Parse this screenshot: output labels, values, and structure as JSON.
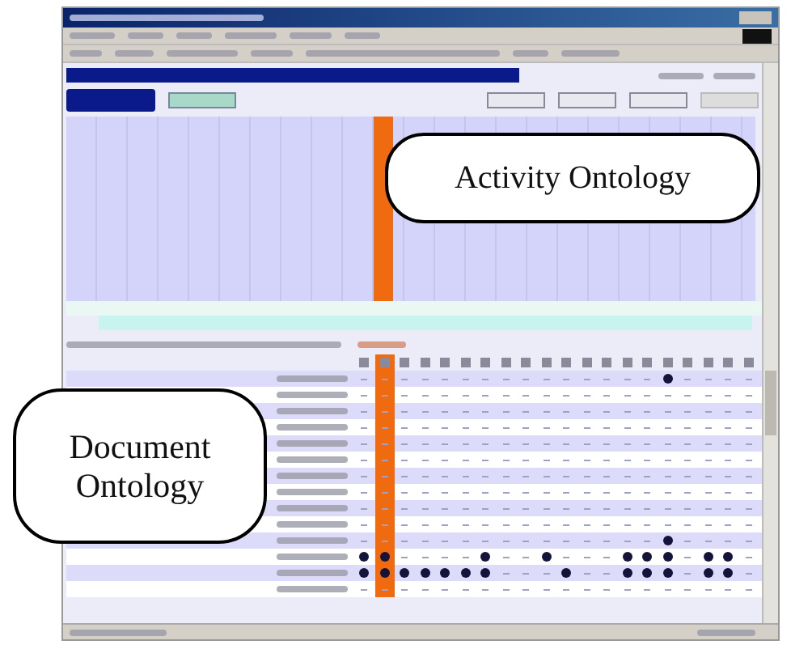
{
  "callouts": [
    {
      "text": "Activity Ontology",
      "kind": "activity"
    },
    {
      "text": "Document Ontology",
      "kind": "document"
    }
  ],
  "matrix": {
    "columns": [
      {
        "selected": false
      },
      {
        "selected": true
      },
      {
        "selected": false
      },
      {
        "selected": false
      },
      {
        "selected": false
      },
      {
        "selected": false
      },
      {
        "selected": false
      },
      {
        "selected": false
      },
      {
        "selected": false
      },
      {
        "selected": false
      },
      {
        "selected": false
      },
      {
        "selected": false
      },
      {
        "selected": false
      },
      {
        "selected": false
      },
      {
        "selected": false
      },
      {
        "selected": false
      },
      {
        "selected": false
      },
      {
        "selected": false
      },
      {
        "selected": false
      },
      {
        "selected": false
      }
    ],
    "rows": [
      {
        "marks": [
          false,
          false,
          false,
          false,
          false,
          false,
          false,
          false,
          false,
          false,
          false,
          false,
          false,
          false,
          false,
          true,
          false,
          false,
          false,
          false
        ]
      },
      {
        "marks": [
          false,
          false,
          false,
          false,
          false,
          false,
          false,
          false,
          false,
          false,
          false,
          false,
          false,
          false,
          false,
          false,
          false,
          false,
          false,
          false
        ]
      },
      {
        "marks": [
          false,
          false,
          false,
          false,
          false,
          false,
          false,
          false,
          false,
          false,
          false,
          false,
          false,
          false,
          false,
          false,
          false,
          false,
          false,
          false
        ]
      },
      {
        "marks": [
          false,
          false,
          false,
          false,
          false,
          false,
          false,
          false,
          false,
          false,
          false,
          false,
          false,
          false,
          false,
          false,
          false,
          false,
          false,
          false
        ]
      },
      {
        "marks": [
          false,
          false,
          false,
          false,
          false,
          false,
          false,
          false,
          false,
          false,
          false,
          false,
          false,
          false,
          false,
          false,
          false,
          false,
          false,
          false
        ]
      },
      {
        "marks": [
          false,
          false,
          false,
          false,
          false,
          false,
          false,
          false,
          false,
          false,
          false,
          false,
          false,
          false,
          false,
          false,
          false,
          false,
          false,
          false
        ]
      },
      {
        "marks": [
          false,
          false,
          false,
          false,
          false,
          false,
          false,
          false,
          false,
          false,
          false,
          false,
          false,
          false,
          false,
          false,
          false,
          false,
          false,
          false
        ]
      },
      {
        "marks": [
          false,
          false,
          false,
          false,
          false,
          false,
          false,
          false,
          false,
          false,
          false,
          false,
          false,
          false,
          false,
          false,
          false,
          false,
          false,
          false
        ]
      },
      {
        "marks": [
          false,
          false,
          false,
          false,
          false,
          false,
          false,
          false,
          false,
          false,
          false,
          false,
          false,
          false,
          false,
          false,
          false,
          false,
          false,
          false
        ]
      },
      {
        "marks": [
          false,
          false,
          false,
          false,
          false,
          false,
          false,
          false,
          false,
          false,
          false,
          false,
          false,
          false,
          false,
          false,
          false,
          false,
          false,
          false
        ]
      },
      {
        "marks": [
          false,
          false,
          false,
          false,
          false,
          false,
          false,
          false,
          false,
          false,
          false,
          false,
          false,
          false,
          false,
          true,
          false,
          false,
          false,
          false
        ]
      },
      {
        "marks": [
          true,
          true,
          false,
          false,
          false,
          false,
          true,
          false,
          false,
          true,
          false,
          false,
          false,
          true,
          true,
          true,
          false,
          true,
          true,
          false
        ]
      },
      {
        "marks": [
          true,
          true,
          true,
          true,
          true,
          true,
          true,
          false,
          false,
          false,
          true,
          false,
          false,
          true,
          true,
          true,
          false,
          true,
          true,
          false
        ]
      },
      {
        "marks": [
          false,
          false,
          false,
          false,
          false,
          false,
          false,
          false,
          false,
          false,
          false,
          false,
          false,
          false,
          false,
          false,
          false,
          false,
          false,
          false
        ]
      }
    ]
  }
}
